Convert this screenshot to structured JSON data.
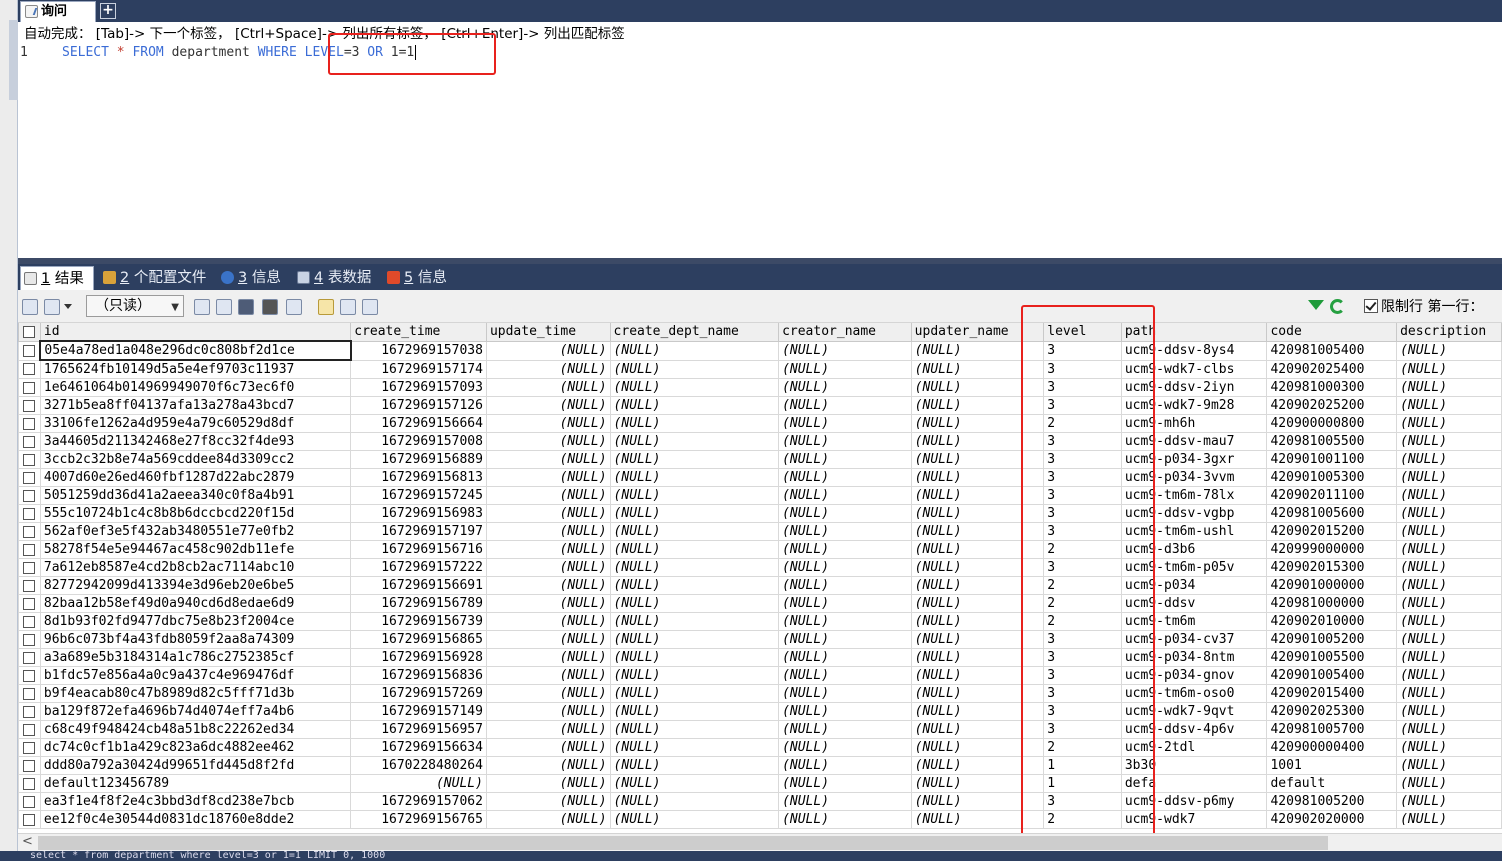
{
  "query_tab": {
    "label": "询问",
    "add_label": "+"
  },
  "hint": "自动完成： [Tab]-> 下一个标签， [Ctrl+Space]-> 列出所有标签， [Ctrl+Enter]-> 列出匹配标签",
  "editor": {
    "line_number": "1",
    "tokens": {
      "select": "SELECT",
      "star": "*",
      "from": "FROM",
      "table": "department",
      "where": "WHERE",
      "level": "LEVEL",
      "eq3": "=3",
      "or": "OR",
      "cond": "1=1"
    }
  },
  "result_tabs": [
    {
      "num": "1",
      "label": "结果"
    },
    {
      "num": "2",
      "label": "个配置文件"
    },
    {
      "num": "3",
      "label": "信息"
    },
    {
      "num": "4",
      "label": "表数据"
    },
    {
      "num": "5",
      "label": "信息"
    }
  ],
  "toolbar": {
    "readonly": "（只读）",
    "limit_rows": "限制行",
    "first_row": "第一行："
  },
  "columns": [
    "id",
    "create_time",
    "update_time",
    "create_dept_name",
    "creator_name",
    "updater_name",
    "level",
    "path",
    "code",
    "description"
  ],
  "rows": [
    [
      "05e4a78ed1a048e296dc0c808bf2d1ce",
      "1672969157038",
      "(NULL)",
      "(NULL)",
      "(NULL)",
      "(NULL)",
      "3",
      "ucm9-ddsv-8ys4",
      "420981005400",
      "(NULL)"
    ],
    [
      "1765624fb10149d5a5e4ef9703c11937",
      "1672969157174",
      "(NULL)",
      "(NULL)",
      "(NULL)",
      "(NULL)",
      "3",
      "ucm9-wdk7-clbs",
      "420902025400",
      "(NULL)"
    ],
    [
      "1e6461064b014969949070f6c73ec6f0",
      "1672969157093",
      "(NULL)",
      "(NULL)",
      "(NULL)",
      "(NULL)",
      "3",
      "ucm9-ddsv-2iyn",
      "420981000300",
      "(NULL)"
    ],
    [
      "3271b5ea8ff04137afa13a278a43bcd7",
      "1672969157126",
      "(NULL)",
      "(NULL)",
      "(NULL)",
      "(NULL)",
      "3",
      "ucm9-wdk7-9m28",
      "420902025200",
      "(NULL)"
    ],
    [
      "33106fe1262a4d959e4a79c60529d8df",
      "1672969156664",
      "(NULL)",
      "(NULL)",
      "(NULL)",
      "(NULL)",
      "2",
      "ucm9-mh6h",
      "420900000800",
      "(NULL)"
    ],
    [
      "3a44605d211342468e27f8cc32f4de93",
      "1672969157008",
      "(NULL)",
      "(NULL)",
      "(NULL)",
      "(NULL)",
      "3",
      "ucm9-ddsv-mau7",
      "420981005500",
      "(NULL)"
    ],
    [
      "3ccb2c32b8e74a569cddee84d3309cc2",
      "1672969156889",
      "(NULL)",
      "(NULL)",
      "(NULL)",
      "(NULL)",
      "3",
      "ucm9-p034-3gxr",
      "420901001100",
      "(NULL)"
    ],
    [
      "4007d60e26ed460fbf1287d22abc2879",
      "1672969156813",
      "(NULL)",
      "(NULL)",
      "(NULL)",
      "(NULL)",
      "3",
      "ucm9-p034-3vvm",
      "420901005300",
      "(NULL)"
    ],
    [
      "5051259dd36d41a2aeea340c0f8a4b91",
      "1672969157245",
      "(NULL)",
      "(NULL)",
      "(NULL)",
      "(NULL)",
      "3",
      "ucm9-tm6m-78lx",
      "420902011100",
      "(NULL)"
    ],
    [
      "555c10724b1c4c8b8b6dccbcd220f15d",
      "1672969156983",
      "(NULL)",
      "(NULL)",
      "(NULL)",
      "(NULL)",
      "3",
      "ucm9-ddsv-vgbp",
      "420981005600",
      "(NULL)"
    ],
    [
      "562af0ef3e5f432ab3480551e77e0fb2",
      "1672969157197",
      "(NULL)",
      "(NULL)",
      "(NULL)",
      "(NULL)",
      "3",
      "ucm9-tm6m-ushl",
      "420902015200",
      "(NULL)"
    ],
    [
      "58278f54e5e94467ac458c902db11efe",
      "1672969156716",
      "(NULL)",
      "(NULL)",
      "(NULL)",
      "(NULL)",
      "2",
      "ucm9-d3b6",
      "420999000000",
      "(NULL)"
    ],
    [
      "7a612eb8587e4cd2b8cb2ac7114abc10",
      "1672969157222",
      "(NULL)",
      "(NULL)",
      "(NULL)",
      "(NULL)",
      "3",
      "ucm9-tm6m-p05v",
      "420902015300",
      "(NULL)"
    ],
    [
      "82772942099d413394e3d96eb20e6be5",
      "1672969156691",
      "(NULL)",
      "(NULL)",
      "(NULL)",
      "(NULL)",
      "2",
      "ucm9-p034",
      "420901000000",
      "(NULL)"
    ],
    [
      "82baa12b58ef49d0a940cd6d8edae6d9",
      "1672969156789",
      "(NULL)",
      "(NULL)",
      "(NULL)",
      "(NULL)",
      "2",
      "ucm9-ddsv",
      "420981000000",
      "(NULL)"
    ],
    [
      "8d1b93f02fd9477dbc75e8b23f2004ce",
      "1672969156739",
      "(NULL)",
      "(NULL)",
      "(NULL)",
      "(NULL)",
      "2",
      "ucm9-tm6m",
      "420902010000",
      "(NULL)"
    ],
    [
      "96b6c073bf4a43fdb8059f2aa8a74309",
      "1672969156865",
      "(NULL)",
      "(NULL)",
      "(NULL)",
      "(NULL)",
      "3",
      "ucm9-p034-cv37",
      "420901005200",
      "(NULL)"
    ],
    [
      "a3a689e5b3184314a1c786c2752385cf",
      "1672969156928",
      "(NULL)",
      "(NULL)",
      "(NULL)",
      "(NULL)",
      "3",
      "ucm9-p034-8ntm",
      "420901005500",
      "(NULL)"
    ],
    [
      "b1fdc57e856a4a0c9a437c4e969476df",
      "1672969156836",
      "(NULL)",
      "(NULL)",
      "(NULL)",
      "(NULL)",
      "3",
      "ucm9-p034-gnov",
      "420901005400",
      "(NULL)"
    ],
    [
      "b9f4eacab80c47b8989d82c5fff71d3b",
      "1672969157269",
      "(NULL)",
      "(NULL)",
      "(NULL)",
      "(NULL)",
      "3",
      "ucm9-tm6m-oso0",
      "420902015400",
      "(NULL)"
    ],
    [
      "ba129f872efa4696b74d4074eff7a4b6",
      "1672969157149",
      "(NULL)",
      "(NULL)",
      "(NULL)",
      "(NULL)",
      "3",
      "ucm9-wdk7-9qvt",
      "420902025300",
      "(NULL)"
    ],
    [
      "c68c49f948424cb48a51b8c22262ed34",
      "1672969156957",
      "(NULL)",
      "(NULL)",
      "(NULL)",
      "(NULL)",
      "3",
      "ucm9-ddsv-4p6v",
      "420981005700",
      "(NULL)"
    ],
    [
      "dc74c0cf1b1a429c823a6dc4882ee462",
      "1672969156634",
      "(NULL)",
      "(NULL)",
      "(NULL)",
      "(NULL)",
      "2",
      "ucm9-2tdl",
      "420900000400",
      "(NULL)"
    ],
    [
      "ddd80a792a30424d99651fd445d8f2fd",
      "1670228480264",
      "(NULL)",
      "(NULL)",
      "(NULL)",
      "(NULL)",
      "1",
      "3b30",
      "1001",
      "(NULL)"
    ],
    [
      "default123456789",
      "(NULL)",
      "(NULL)",
      "(NULL)",
      "(NULL)",
      "(NULL)",
      "1",
      "defa",
      "default",
      "(NULL)"
    ],
    [
      "ea3f1e4f8f2e4c3bbd3df8cd238e7bcb",
      "1672969157062",
      "(NULL)",
      "(NULL)",
      "(NULL)",
      "(NULL)",
      "3",
      "ucm9-ddsv-p6my",
      "420981005200",
      "(NULL)"
    ],
    [
      "ee12f0c4e30544d0831dc18760e8dde2",
      "1672969156765",
      "(NULL)",
      "(NULL)",
      "(NULL)",
      "(NULL)",
      "2",
      "ucm9-wdk7",
      "420902020000",
      "(NULL)"
    ]
  ],
  "status": "select * from department where level=3 or 1=1 LIMIT 0, 1000"
}
